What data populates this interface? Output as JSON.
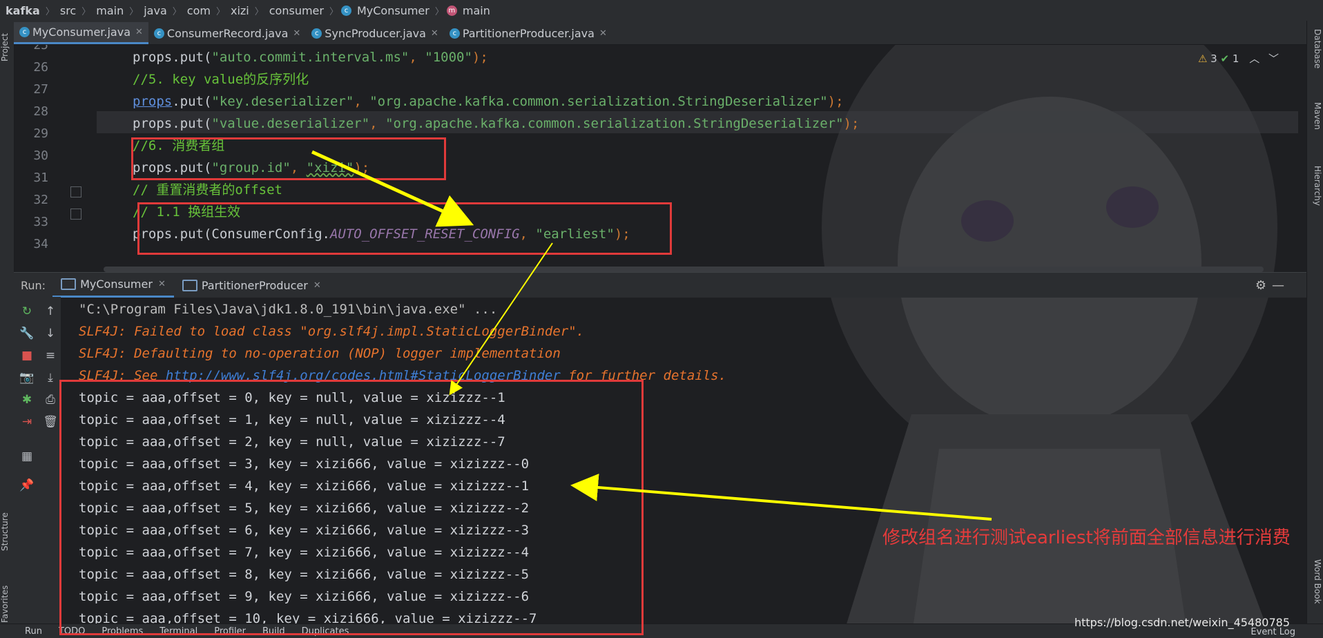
{
  "breadcrumb": [
    "kafka",
    "src",
    "main",
    "java",
    "com",
    "xizi",
    "consumer",
    "MyConsumer",
    "main"
  ],
  "tabs": [
    "MyConsumer.java",
    "ConsumerRecord.java",
    "SyncProducer.java",
    "PartitionerProducer.java"
  ],
  "left_stripe": {
    "project": "Project",
    "structure": "Structure",
    "favorites": "Favorites"
  },
  "right_stripe": {
    "database": "Database",
    "maven": "Maven",
    "hierarchy": "Hierarchy",
    "word_book": "Word Book"
  },
  "inspections": {
    "warnings": "3",
    "ok": "1"
  },
  "editor": {
    "line_numbers": [
      "25",
      "26",
      "27",
      "28",
      "29",
      "30",
      "31",
      "32",
      "33",
      "34"
    ],
    "l25": {
      "a": "props.put(",
      "s1": "\"auto.commit.interval.ms\"",
      "b": ", ",
      "s2": "\"1000\"",
      "c": ");"
    },
    "l26": "//5. key value的反序列化",
    "l27": {
      "a": "props",
      "b": ".put(",
      "s1": "\"key.deserializer\"",
      "c": ", ",
      "s2": "\"org.apache.kafka.common.serialization.StringDeserializer\"",
      "d": ");"
    },
    "l28": {
      "a": "props.put(",
      "s1": "\"value.deserializer\"",
      "b": ", ",
      "s2": "\"org.apache.kafka.common.serialization.StringDeserializer\"",
      "c": ");"
    },
    "l29": "//6. 消费者组",
    "l30": {
      "a": "props.put(",
      "s1": "\"group.id\"",
      "b": ", ",
      "s2": "\"xizi\"",
      "c": ");"
    },
    "l31": "// 重置消费者的offset",
    "l32": "// 1.1 换组生效",
    "l33": {
      "a": "props.put(ConsumerConfig.",
      "cst": "AUTO_OFFSET_RESET_CONFIG",
      "b": ", ",
      "s1": "\"earliest\"",
      "c": ");"
    }
  },
  "run": {
    "label": "Run:",
    "tabs": [
      "MyConsumer",
      "PartitionerProducer"
    ]
  },
  "console": {
    "cmd": "\"C:\\Program Files\\Java\\jdk1.8.0_191\\bin\\java.exe\" ...",
    "err1": "SLF4J: Failed to load class \"org.slf4j.impl.StaticLoggerBinder\".",
    "err2": "SLF4J: Defaulting to no-operation (NOP) logger implementation",
    "err3_a": "SLF4J: See ",
    "err3_link": "http://www.slf4j.org/codes.html#StaticLoggerBinder",
    "err3_b": " for further details.",
    "records": [
      "topic = aaa,offset = 0, key = null, value = xizizzz--1",
      "topic = aaa,offset = 1, key = null, value = xizizzz--4",
      "topic = aaa,offset = 2, key = null, value = xizizzz--7",
      "topic = aaa,offset = 3, key = xizi666, value = xizizzz--0",
      "topic = aaa,offset = 4, key = xizi666, value = xizizzz--1",
      "topic = aaa,offset = 5, key = xizi666, value = xizizzz--2",
      "topic = aaa,offset = 6, key = xizi666, value = xizizzz--3",
      "topic = aaa,offset = 7, key = xizi666, value = xizizzz--4",
      "topic = aaa,offset = 8, key = xizi666, value = xizizzz--5",
      "topic = aaa,offset = 9, key = xizi666, value = xizizzz--6",
      "topic = aaa,offset = 10, key = xizi666, value = xizizzz--7"
    ]
  },
  "annotation": "修改组名进行测试earliest将前面全部信息进行消费",
  "bottom_bar": [
    "Run",
    "TODO",
    "Problems",
    "Terminal",
    "Profiler",
    "Build",
    "Duplicates"
  ],
  "watermark": "https://blog.csdn.net/weixin_45480785",
  "event_log": "Event Log",
  "colors": {
    "accent": "#4a88c7",
    "highlight_box": "#e03a3a",
    "arrow": "#ffff00"
  }
}
